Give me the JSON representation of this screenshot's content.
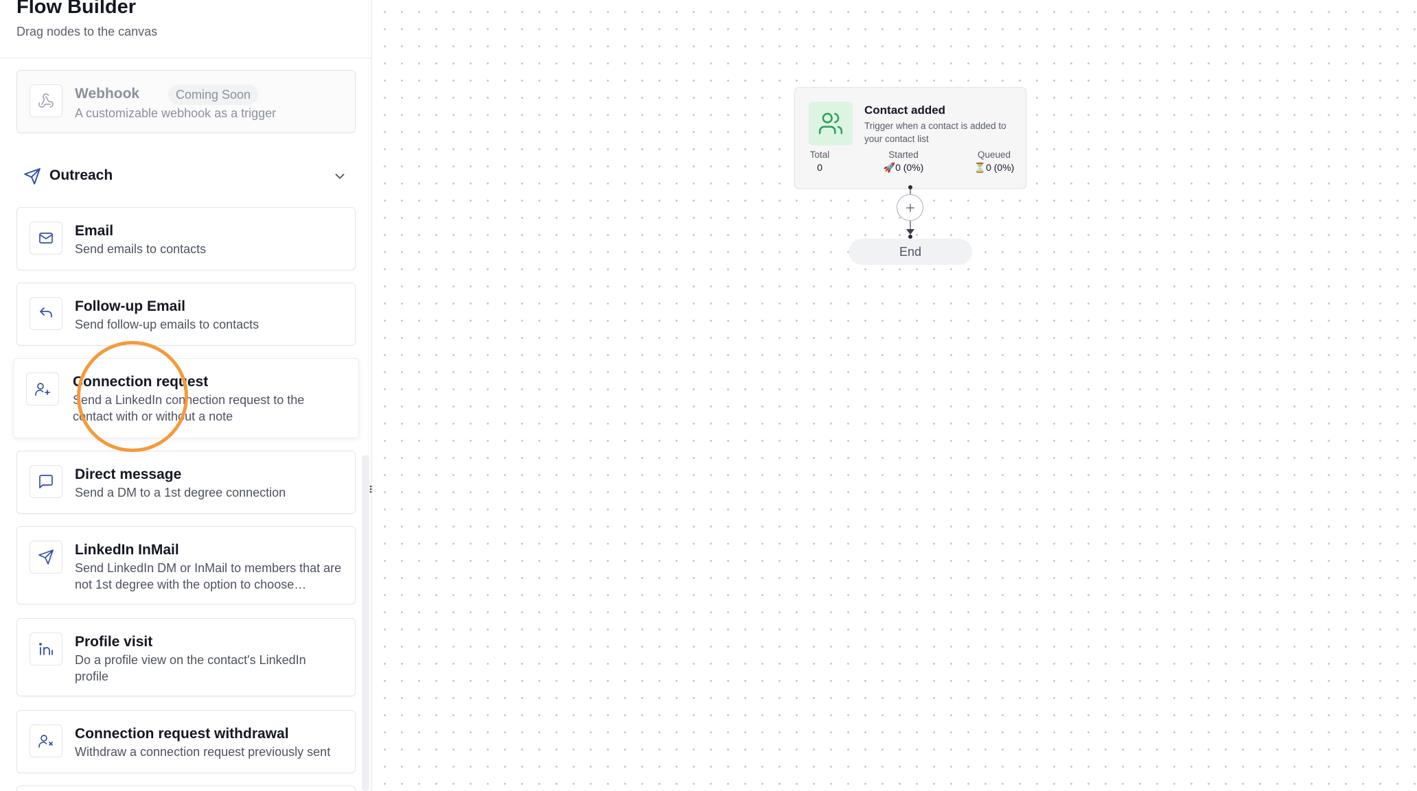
{
  "sidebar": {
    "title": "Flow Builder",
    "subtitle": "Drag nodes to the canvas",
    "webhook": {
      "title": "Webhook",
      "badge": "Coming Soon",
      "description": "A customizable webhook as a trigger"
    },
    "section": {
      "label": "Outreach",
      "icon": "send-icon",
      "expanded": true
    },
    "items": [
      {
        "title": "Email",
        "description": "Send emails to contacts",
        "icon": "mail-icon"
      },
      {
        "title": "Follow-up Email",
        "description": "Send follow-up emails to contacts",
        "icon": "reply-icon"
      },
      {
        "title": "Connection request",
        "description": "Send a LinkedIn connection request to the contact with or without a note",
        "icon": "user-plus-icon"
      },
      {
        "title": "Direct message",
        "description": "Send a DM to a 1st degree connection",
        "icon": "message-icon"
      },
      {
        "title": "LinkedIn InMail",
        "description": "Send LinkedIn DM or InMail to members that are not 1st degree with the option to choose…",
        "icon": "send-icon"
      },
      {
        "title": "Profile visit",
        "description": "Do a profile view on the contact's LinkedIn profile",
        "icon": "linkedin-icon"
      },
      {
        "title": "Connection request withdrawal",
        "description": "Withdraw a connection request previously sent",
        "icon": "user-x-icon"
      }
    ]
  },
  "canvas": {
    "trigger_node": {
      "title": "Contact added",
      "description": "Trigger when a contact is added to your contact list",
      "icon": "users-icon",
      "stats": {
        "total_label": "Total",
        "total_value": "0",
        "started_label": "Started",
        "started_value": "🚀0 (0%)",
        "queued_label": "Queued",
        "queued_value": "⏳0 (0%)"
      }
    },
    "end_node": {
      "label": "End"
    }
  },
  "colors": {
    "accent": "#2f4fa8",
    "trigger_icon_bg": "#dcf5e3",
    "trigger_icon": "#2e9e55",
    "click_highlight": "#f59a3b"
  }
}
